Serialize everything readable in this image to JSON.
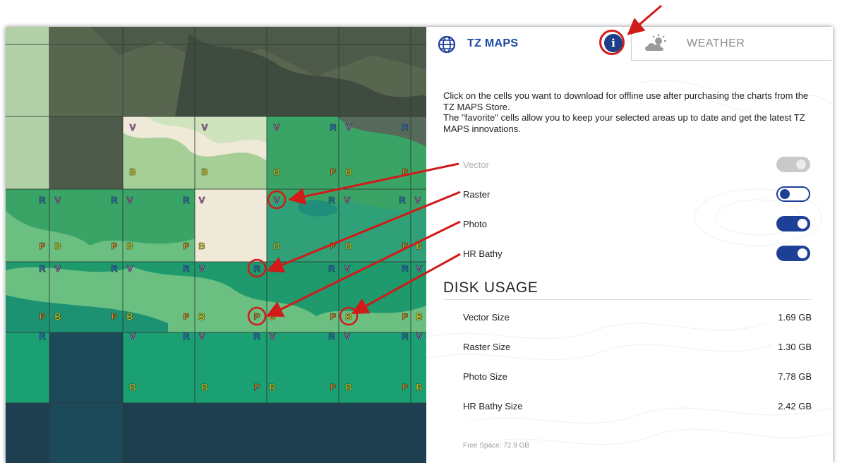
{
  "tabs": {
    "tz_maps_label": "TZ MAPS",
    "weather_label": "WEATHER",
    "info_glyph": "i"
  },
  "intro": {
    "line1": "Click on the cells you want to download for offline use after purchasing the charts from the TZ MAPS Store.",
    "line2": "The \"favorite\" cells allow you to keep your selected areas up to date and get the latest TZ MAPS innovations."
  },
  "layers": [
    {
      "label": "Vector",
      "state": "disabled"
    },
    {
      "label": "Raster",
      "state": "off"
    },
    {
      "label": "Photo",
      "state": "on"
    },
    {
      "label": "HR Bathy",
      "state": "on"
    }
  ],
  "disk_usage": {
    "title": "DISK USAGE",
    "rows": [
      {
        "label": "Vector Size",
        "value": "1.69 GB"
      },
      {
        "label": "Raster Size",
        "value": "1.30 GB"
      },
      {
        "label": "Photo Size",
        "value": "7.78 GB"
      },
      {
        "label": "HR Bathy Size",
        "value": "2.42 GB"
      }
    ],
    "free_space": "Free Space: 72.9 GB"
  },
  "map": {
    "badge_letters": {
      "raster": "R",
      "vector": "V",
      "photo": "P",
      "bathy": "B"
    },
    "colors": {
      "raster": "#2f7fd8",
      "vector": "#d070e0",
      "photo": "#f08a1c",
      "bathy": "#f2e21a",
      "accent_blue": "#1d3f96",
      "highlight_red": "#d11a1a"
    }
  }
}
